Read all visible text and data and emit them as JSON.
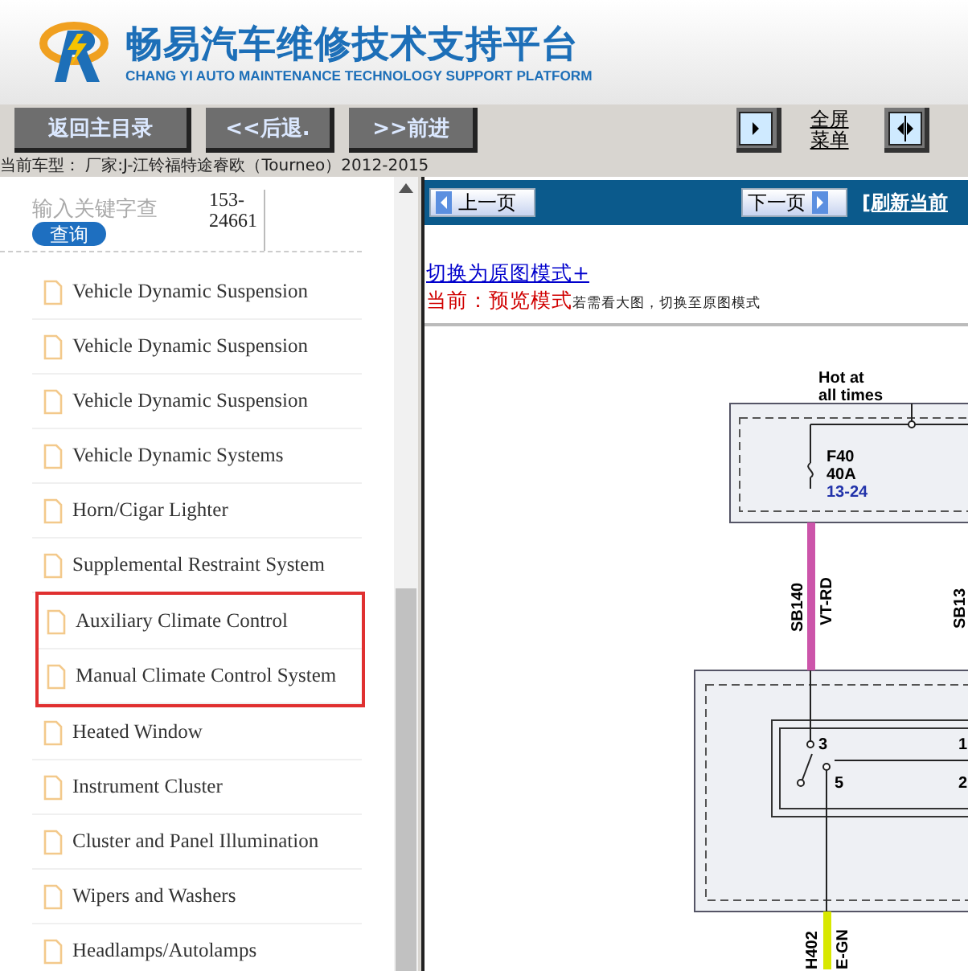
{
  "header": {
    "title": "畅易汽车维修技术支持平台",
    "subtitle": "CHANG YI AUTO MAINTENANCE TECHNOLOGY SUPPORT PLATFORM"
  },
  "toolbar": {
    "buttons": [
      "返回主目录",
      "<<后退.",
      ">>前进"
    ],
    "fullscreen_label": "全屏菜单"
  },
  "car_model": "当前车型：  厂家:J-江铃福特途睿欧（Tourneo）2012-2015",
  "sidebar": {
    "search": {
      "placeholder": "输入关键字查",
      "button": "查询"
    },
    "code": "153-24661",
    "items": [
      {
        "label": "Vehicle Dynamic Suspension",
        "highlighted": false
      },
      {
        "label": "Vehicle Dynamic Suspension",
        "highlighted": false
      },
      {
        "label": "Vehicle Dynamic Suspension",
        "highlighted": false
      },
      {
        "label": "Vehicle Dynamic Systems",
        "highlighted": false
      },
      {
        "label": "Horn/Cigar Lighter",
        "highlighted": false
      },
      {
        "label": "Supplemental Restraint System",
        "highlighted": false
      },
      {
        "label": "Auxiliary Climate Control",
        "highlighted": true
      },
      {
        "label": "Manual Climate Control System",
        "highlighted": true
      },
      {
        "label": "Heated Window",
        "highlighted": false
      },
      {
        "label": "Instrument Cluster",
        "highlighted": false
      },
      {
        "label": "Cluster and Panel Illumination",
        "highlighted": false
      },
      {
        "label": "Wipers and Washers",
        "highlighted": false
      },
      {
        "label": "Headlamps/Autolamps",
        "highlighted": false
      }
    ]
  },
  "content": {
    "prev_button": "上一页",
    "next_button": "下一页",
    "refresh_link": "[刷新当前",
    "mode_link": "切换为原图模式+",
    "mode_status": "当前：预览模式",
    "mode_hint": "若需看大图，切换至原图模式",
    "diagram": {
      "supply": [
        "Hot at",
        "all times"
      ],
      "fuse": {
        "name": "F40",
        "rating": "40A",
        "ref": "13-24"
      },
      "wires": [
        {
          "circuit": "SB140",
          "code": "VT-RD",
          "color": "#cc55aa"
        },
        {
          "circuit": "SB13"
        },
        {
          "circuit": "H402",
          "code": "E-GN",
          "color": "#d8e800"
        }
      ],
      "pins": [
        "3",
        "5",
        "1",
        "2"
      ]
    }
  }
}
